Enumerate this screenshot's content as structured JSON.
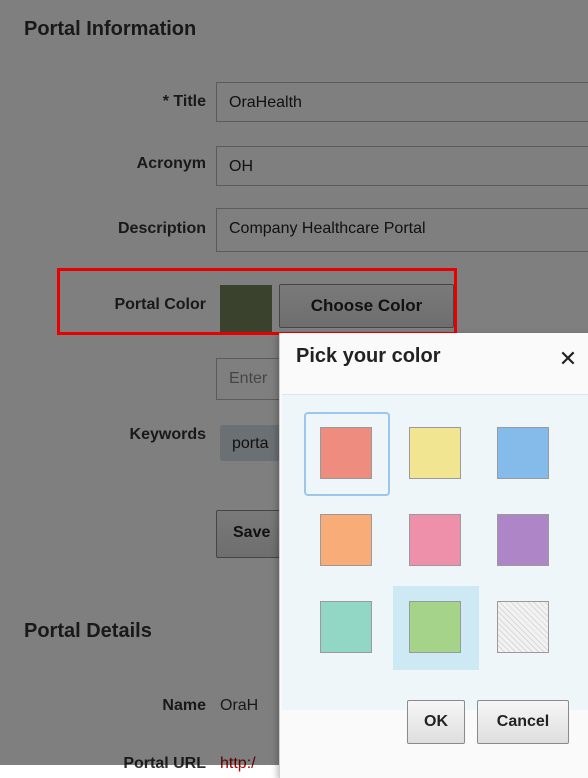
{
  "portal_information": {
    "title": "Portal Information",
    "fields": {
      "title_label": "* Title",
      "title_value": "OraHealth",
      "acronym_label": "Acronym",
      "acronym_value": "OH",
      "description_label": "Description",
      "description_value": "Company Healthcare Portal",
      "portal_color_label": "Portal Color",
      "portal_color_value": "#74835a",
      "choose_color_label": "Choose Color",
      "keywords_label": "Keywords",
      "keywords_placeholder": "Enter",
      "keyword_tag": "porta"
    },
    "save_label": "Save"
  },
  "portal_details": {
    "title": "Portal Details",
    "name_label": "Name",
    "name_value": "OraH",
    "url_label": "Portal URL",
    "url_value": "http:/"
  },
  "color_picker": {
    "title": "Pick your color",
    "close_icon": "close-icon",
    "colors": [
      {
        "name": "red",
        "hex": "#ef8c80",
        "selected": true
      },
      {
        "name": "yellow",
        "hex": "#f2e591"
      },
      {
        "name": "blue",
        "hex": "#84bbea"
      },
      {
        "name": "orange",
        "hex": "#f8ad78"
      },
      {
        "name": "pink",
        "hex": "#ee90aa"
      },
      {
        "name": "purple",
        "hex": "#ae85c6"
      },
      {
        "name": "teal",
        "hex": "#92d6c6"
      },
      {
        "name": "green",
        "hex": "#a6d38a",
        "hovered": true
      },
      {
        "name": "none",
        "hex": "#f2f2f2"
      }
    ],
    "ok_label": "OK",
    "cancel_label": "Cancel"
  },
  "highlight_color": "#e60000"
}
